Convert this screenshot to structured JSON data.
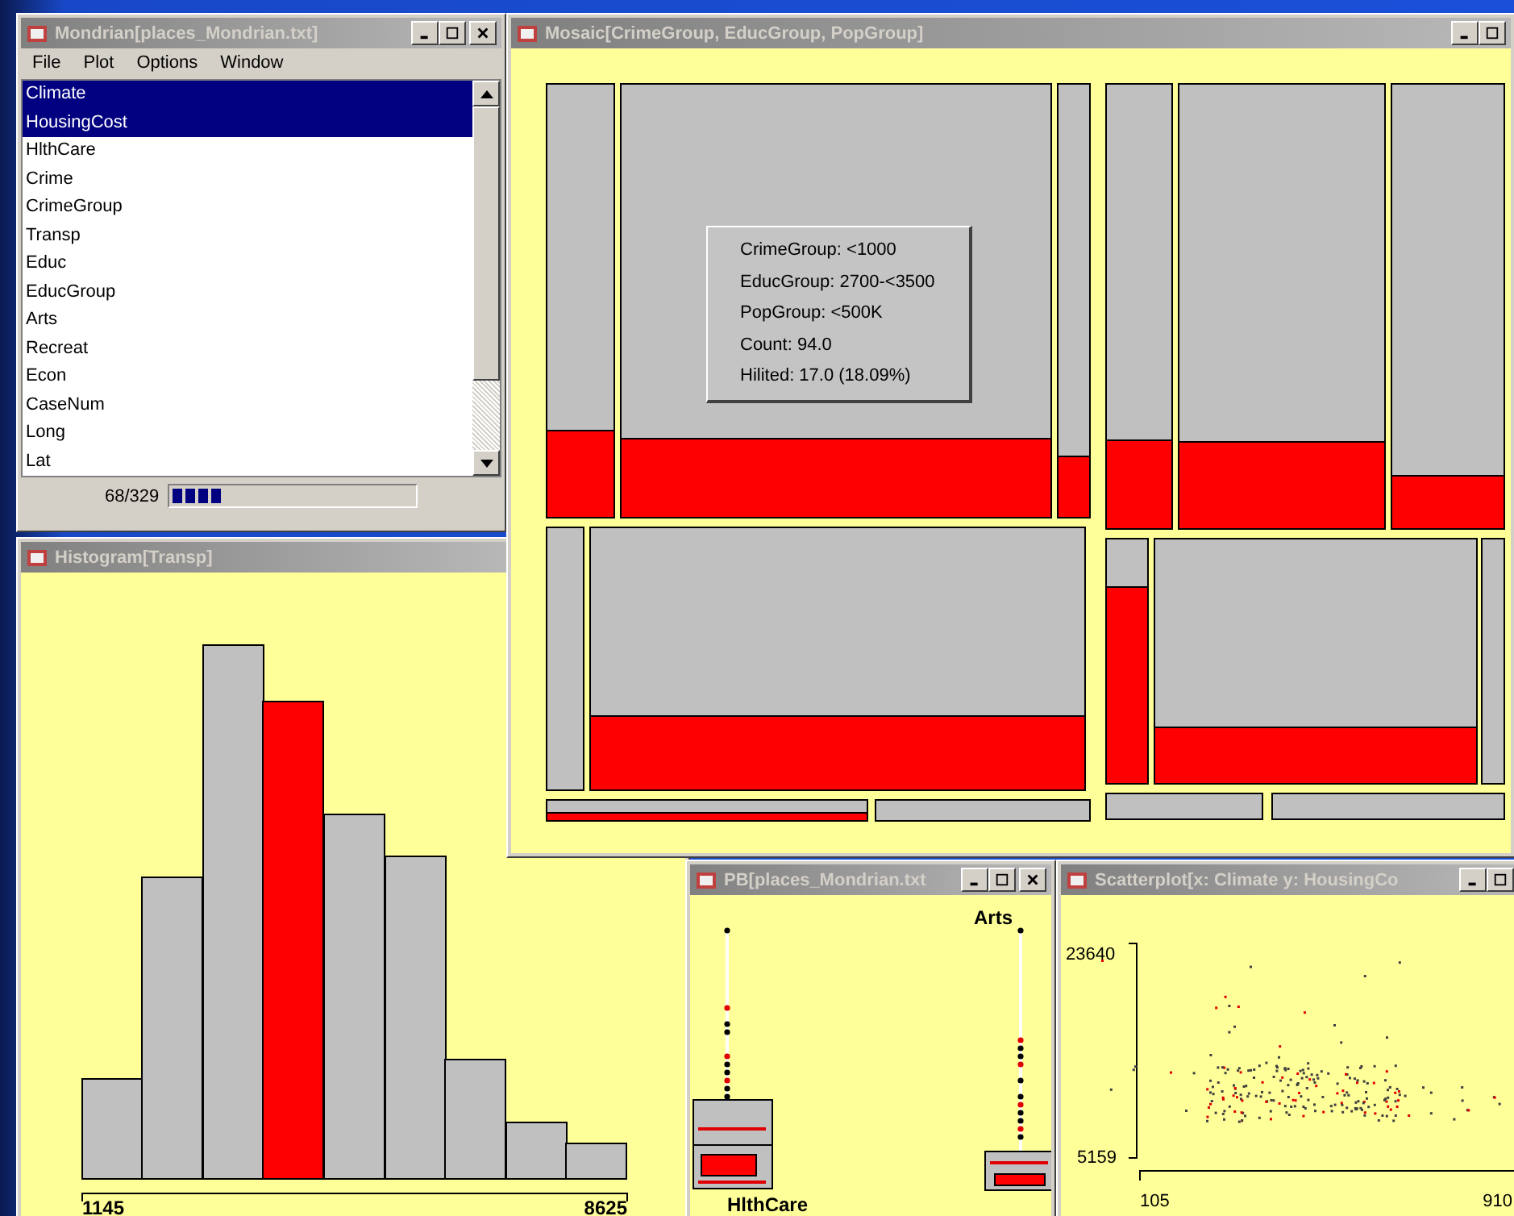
{
  "main_window": {
    "title": "Mondrian[places_Mondrian.txt]",
    "menu": [
      "File",
      "Plot",
      "Options",
      "Window"
    ],
    "variables": [
      {
        "label": "Climate",
        "selected": true
      },
      {
        "label": "HousingCost",
        "selected": true
      },
      {
        "label": "HlthCare",
        "selected": false
      },
      {
        "label": "Crime",
        "selected": false
      },
      {
        "label": "CrimeGroup",
        "selected": false
      },
      {
        "label": "Transp",
        "selected": false
      },
      {
        "label": "Educ",
        "selected": false
      },
      {
        "label": "EducGroup",
        "selected": false
      },
      {
        "label": "Arts",
        "selected": false
      },
      {
        "label": "Recreat",
        "selected": false
      },
      {
        "label": "Econ",
        "selected": false
      },
      {
        "label": "CaseNum",
        "selected": false
      },
      {
        "label": "Long",
        "selected": false
      },
      {
        "label": "Lat",
        "selected": false
      }
    ],
    "selection_count": "68/329",
    "selection": {
      "level": 0.207
    }
  },
  "mosaic_window": {
    "title": "Mosaic[CrimeGroup, EducGroup, PopGroup]",
    "tooltip": [
      "CrimeGroup: <1000",
      "EducGroup: 2700-<3500",
      "PopGroup: <500K",
      "Count: 94.0",
      "Hilited: 17.0 (18.09%)"
    ]
  },
  "histogram_window": {
    "title": "Histogram[Transp]",
    "axis_min": "1145",
    "axis_max": "8625"
  },
  "boxplot_window": {
    "title": "PB[places_Mondrian.txt",
    "plots": [
      {
        "label": "HlthCare"
      },
      {
        "label": "Arts"
      }
    ]
  },
  "scatterplot_window": {
    "title": "Scatterplot[x: Climate y: HousingCo",
    "y_max": "23640",
    "y_min": "5159",
    "x_min": "105",
    "x_max": "910"
  }
}
